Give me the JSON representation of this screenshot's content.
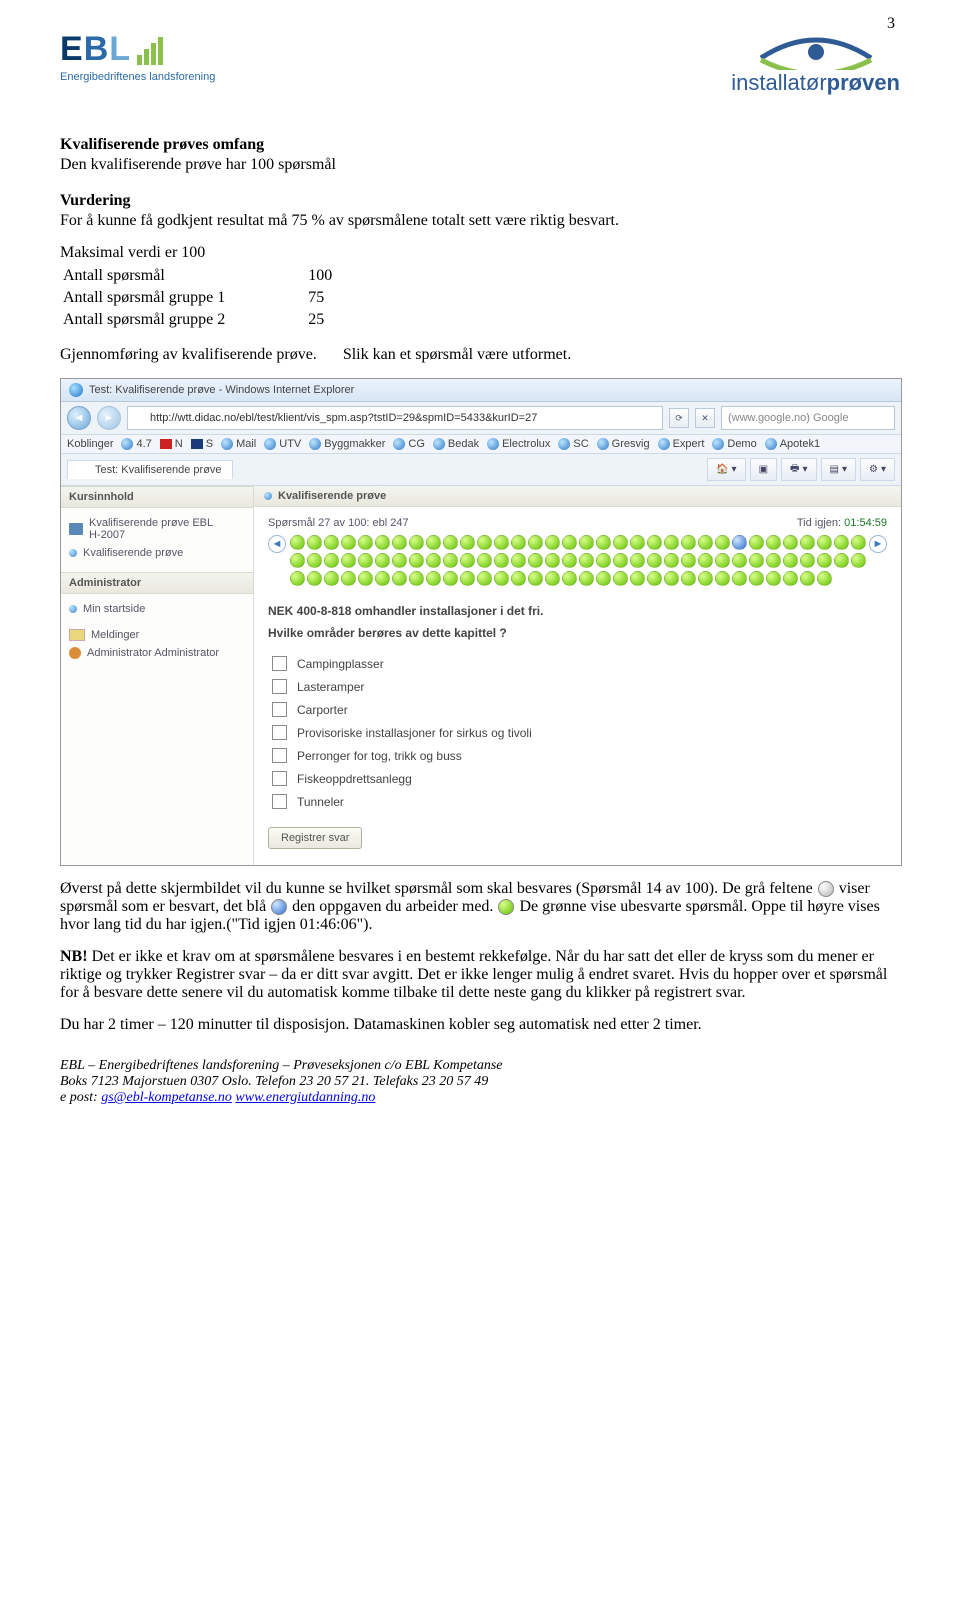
{
  "page_number": "3",
  "logos": {
    "ebl_sub": "Energibedriftenes landsforening",
    "ip_normal": "installatør",
    "ip_bold": "prøven"
  },
  "sec1_h": "Kvalifiserende prøves omfang",
  "sec1_p": "Den kvalifiserende prøve har 100 spørsmål",
  "sec2_h": "Vurdering",
  "sec2_p": "For å kunne få godkjent resultat må 75 % av spørsmålene totalt sett være riktig besvart.",
  "sec3_p": "Maksimal verdi er 100",
  "stats": {
    "r1_l": "Antall spørsmål",
    "r1_v": "100",
    "r2_l": "Antall spørsmål gruppe 1",
    "r2_v": "75",
    "r3_l": "Antall spørsmål gruppe 2",
    "r3_v": "25"
  },
  "sec4_l": "Gjennomføring av kvalifiserende prøve.",
  "sec4_r": "Slik kan et spørsmål være utformet.",
  "browser": {
    "title": "Test: Kvalifiserende prøve - Windows Internet Explorer",
    "url": "http://wtt.didac.no/ebl/test/klient/vis_spm.asp?tstID=29&spmID=5433&kurID=27",
    "search_placeholder": "(www.google.no) Google",
    "links_label": "Koblinger",
    "links": [
      "4.7",
      "N",
      "S",
      "Mail",
      "UTV",
      "Byggmakker",
      "CG",
      "Bedak",
      "Electrolux",
      "SC",
      "Gresvig",
      "Expert",
      "Demo",
      "Apotek1"
    ],
    "tab": "Test: Kvalifiserende prøve",
    "sidebar": {
      "hd1": "Kursinnhold",
      "link1a": "Kvalifiserende prøve EBL",
      "link1b": "H-2007",
      "link2": "Kvalifiserende prøve",
      "hd2": "Administrator",
      "link3": "Min startside",
      "link4": "Meldinger",
      "link5": "Administrator Administrator"
    },
    "main": {
      "hd": "Kvalifiserende prøve",
      "qinfo": "Spørsmål 27 av 100: ebl 247",
      "timelabel": "Tid igjen:",
      "timeval": "01:54:59",
      "qtext": "NEK 400-8-818 omhandler installasjoner i det fri.",
      "qsub": "Hvilke områder berøres av dette kapittel ?",
      "opts": [
        "Campingplasser",
        "Lasteramper",
        "Carporter",
        "Provisoriske installasjoner for sirkus og tivoli",
        "Perronger for tog, trikk og buss",
        "Fiskeoppdrettsanlegg",
        "Tunneler"
      ],
      "reg": "Registrer svar"
    }
  },
  "after1a": "Øverst på dette skjermbildet vil du kunne se hvilket spørsmål som skal besvares (Spørsmål 14 av 100). De grå feltene ",
  "after1b": " viser spørsmål som er besvart, det blå ",
  "after1c": " den oppgaven du arbeider med. ",
  "after1d": "De grønne vise ubesvarte spørsmål. Oppe til høyre vises hvor lang tid du har igjen.(\"Tid igjen 01:46:06\").",
  "nb_label": "NB!",
  "nb_text": " Det er ikke et krav om at spørsmålene besvares i en bestemt rekkefølge. Når du har satt det eller de kryss som du mener er riktige og trykker Registrer svar – da er ditt svar avgitt. Det er ikke lenger mulig å endret svaret. Hvis du hopper over et spørsmål for å besvare dette senere vil du automatisk komme tilbake til dette neste gang du klikker på registrert svar.",
  "last_p": "Du har 2 timer – 120 minutter til disposisjon. Datamaskinen kobler seg automatisk ned etter 2 timer.",
  "footer": {
    "l1": "EBL – Energibedriftenes landsforening – Prøveseksjonen c/o EBL Kompetanse",
    "l2": "Boks 7123 Majorstuen 0307 Oslo.  Telefon  23 20 57 21. Telefaks 23 20 57 49",
    "l3a": "e post: ",
    "mail": "gs@ebl-kompetanse.no",
    "sp": "  ",
    "web": "www.energiutdanning.no"
  }
}
